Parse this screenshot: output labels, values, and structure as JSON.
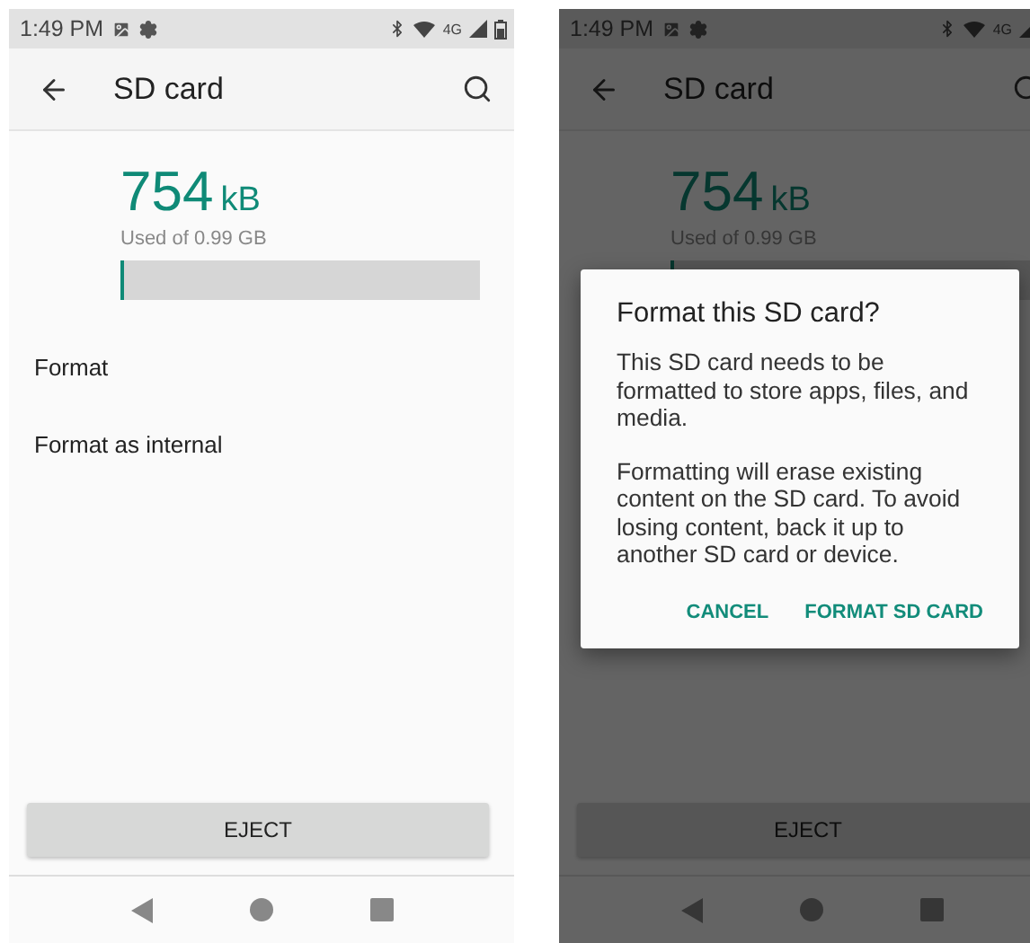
{
  "screens": [
    {
      "dimmed": false,
      "status_bar": {
        "time": "1:49 PM",
        "network": "4G"
      },
      "app_bar": {
        "title": "SD card"
      },
      "storage": {
        "amount": "754",
        "unit": "kB",
        "caption": "Used of 0.99 GB",
        "level": 0.01
      },
      "menu_items": [
        "Format",
        "Format as internal"
      ],
      "eject_button": "EJECT"
    },
    {
      "dimmed": true,
      "status_bar": {
        "time": "1:49 PM",
        "network": "4G"
      },
      "app_bar": {
        "title": "SD card"
      },
      "storage": {
        "amount": "754",
        "unit": "kB",
        "caption": "Used of 0.99 GB",
        "level": 0.01
      },
      "eject_button": "EJECT",
      "dialog": {
        "title": "Format this SD card?",
        "paragraphs": [
          "This SD card needs to be formatted to store apps, files, and media.",
          "Formatting will erase existing content on the SD card. To avoid losing content, back it up to another SD card or device."
        ],
        "actions": [
          "CANCEL",
          "FORMAT SD CARD"
        ]
      }
    }
  ]
}
